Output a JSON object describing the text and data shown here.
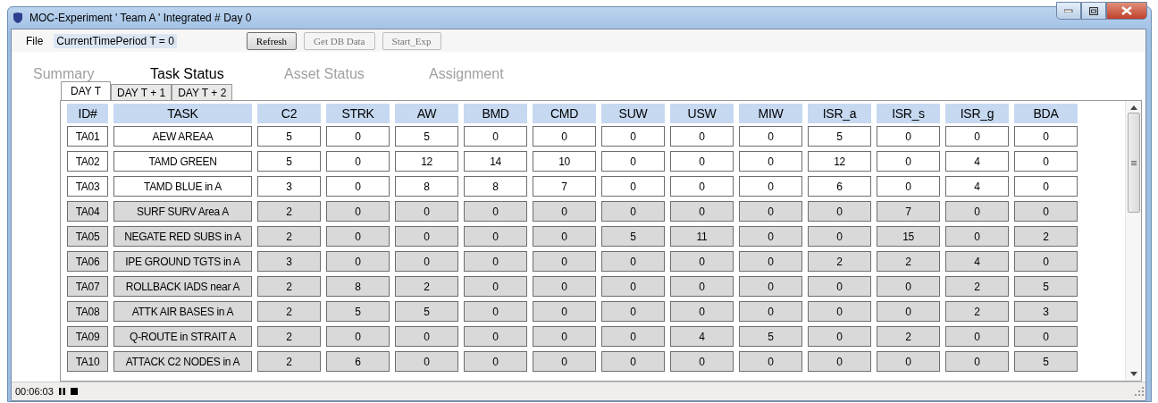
{
  "window": {
    "title": "MOC-Experiment ' Team A '  Integrated # Day 0"
  },
  "menu": {
    "file": "File",
    "period": "CurrentTimePeriod T = 0"
  },
  "buttons": [
    {
      "label": "Refresh",
      "disabled": false
    },
    {
      "label": "Get DB Data",
      "disabled": true
    },
    {
      "label": "Start_Exp",
      "disabled": true
    }
  ],
  "tabs": [
    {
      "label": "Summary",
      "selected": false
    },
    {
      "label": "Task Status",
      "selected": true
    },
    {
      "label": "Asset Status",
      "selected": false
    },
    {
      "label": "Assignment",
      "selected": false
    }
  ],
  "day_tabs": [
    {
      "label": "DAY T",
      "selected": true
    },
    {
      "label": "DAY T + 1",
      "selected": false
    },
    {
      "label": "DAY T + 2",
      "selected": false
    }
  ],
  "table": {
    "columns": [
      "ID#",
      "TASK",
      "C2",
      "STRK",
      "AW",
      "BMD",
      "CMD",
      "SUW",
      "USW",
      "MIW",
      "ISR_a",
      "ISR_s",
      "ISR_g",
      "BDA"
    ],
    "rows": [
      {
        "disabled": false,
        "cells": [
          "TA01",
          "AEW AREAA",
          "5",
          "0",
          "5",
          "0",
          "0",
          "0",
          "0",
          "0",
          "5",
          "0",
          "0",
          "0"
        ]
      },
      {
        "disabled": false,
        "cells": [
          "TA02",
          "TAMD GREEN",
          "5",
          "0",
          "12",
          "14",
          "10",
          "0",
          "0",
          "0",
          "12",
          "0",
          "4",
          "0"
        ]
      },
      {
        "disabled": false,
        "cells": [
          "TA03",
          "TAMD BLUE in A",
          "3",
          "0",
          "8",
          "8",
          "7",
          "0",
          "0",
          "0",
          "6",
          "0",
          "4",
          "0"
        ]
      },
      {
        "disabled": true,
        "cells": [
          "TA04",
          "SURF SURV Area A",
          "2",
          "0",
          "0",
          "0",
          "0",
          "0",
          "0",
          "0",
          "0",
          "7",
          "0",
          "0"
        ]
      },
      {
        "disabled": true,
        "cells": [
          "TA05",
          "NEGATE RED SUBS in A",
          "2",
          "0",
          "0",
          "0",
          "0",
          "5",
          "11",
          "0",
          "0",
          "15",
          "0",
          "2"
        ]
      },
      {
        "disabled": true,
        "cells": [
          "TA06",
          "IPE GROUND TGTS in A",
          "3",
          "0",
          "0",
          "0",
          "0",
          "0",
          "0",
          "0",
          "2",
          "2",
          "4",
          "0"
        ]
      },
      {
        "disabled": true,
        "cells": [
          "TA07",
          "ROLLBACK IADS near A",
          "2",
          "8",
          "2",
          "0",
          "0",
          "0",
          "0",
          "0",
          "0",
          "0",
          "2",
          "5"
        ]
      },
      {
        "disabled": true,
        "cells": [
          "TA08",
          "ATTK AIR BASES in A",
          "2",
          "5",
          "5",
          "0",
          "0",
          "0",
          "0",
          "0",
          "0",
          "0",
          "2",
          "3"
        ]
      },
      {
        "disabled": true,
        "cells": [
          "TA09",
          "Q-ROUTE in STRAIT A",
          "2",
          "0",
          "0",
          "0",
          "0",
          "0",
          "4",
          "5",
          "0",
          "2",
          "0",
          "0"
        ]
      },
      {
        "disabled": true,
        "cells": [
          "TA10",
          "ATTACK C2 NODES in A",
          "2",
          "6",
          "0",
          "0",
          "0",
          "0",
          "0",
          "0",
          "0",
          "0",
          "0",
          "5"
        ]
      }
    ]
  },
  "status_bar": {
    "time": "00:06:03"
  }
}
